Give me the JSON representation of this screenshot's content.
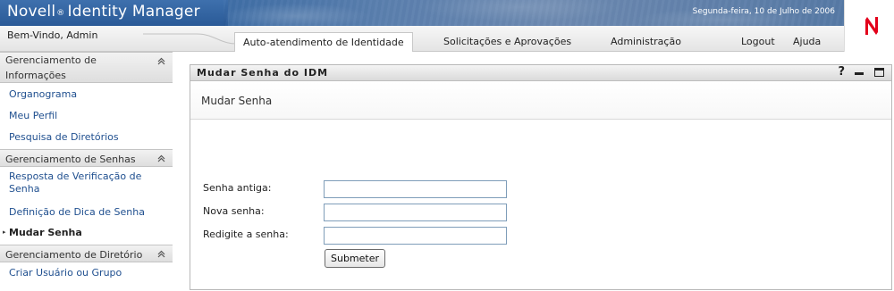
{
  "header": {
    "app_title_left": "Novell",
    "app_title_reg": "®",
    "app_title_right": "Identity Manager",
    "date": "Segunda-feira, 10 de Julho de 2006",
    "welcome": "Bem-Vindo, Admin",
    "logo_letter": "N",
    "logo_color": "#e3001b"
  },
  "nav": {
    "tabs": [
      {
        "label": "Auto-atendimento de Identidade",
        "active": true
      },
      {
        "label": "Solicitações e Aprovações",
        "active": false
      },
      {
        "label": "Administração",
        "active": false
      }
    ],
    "logout": "Logout",
    "help": "Ajuda"
  },
  "sidebar": {
    "groups": [
      {
        "title": "Gerenciamento de Informações",
        "title_line1": "Gerenciamento de",
        "title_line2": "Informações",
        "items": [
          "Organograma",
          "Meu Perfil",
          "Pesquisa de Diretórios"
        ]
      },
      {
        "title": "Gerenciamento de Senhas",
        "items": [
          "Resposta de Verificação de Senha",
          "Definição de Dica de Senha",
          "Mudar Senha"
        ],
        "item0_line1": "Resposta de Verificação de",
        "item0_line2": "Senha",
        "current_item": "Mudar Senha"
      },
      {
        "title": "Gerenciamento de Diretório",
        "items": [
          "Criar Usuário ou Grupo"
        ]
      }
    ]
  },
  "portlet": {
    "title": "Mudar Senha do IDM",
    "help_icon": "?",
    "form_title": "Mudar Senha",
    "fields": [
      {
        "label": "Senha antiga:",
        "value": ""
      },
      {
        "label": "Nova senha:",
        "value": ""
      },
      {
        "label": "Redigite a senha:",
        "value": ""
      }
    ],
    "submit_label": "Submeter"
  },
  "colors": {
    "banner": "#3a6aa5",
    "link": "#1f4f8f",
    "input_border": "#7f9db9"
  }
}
